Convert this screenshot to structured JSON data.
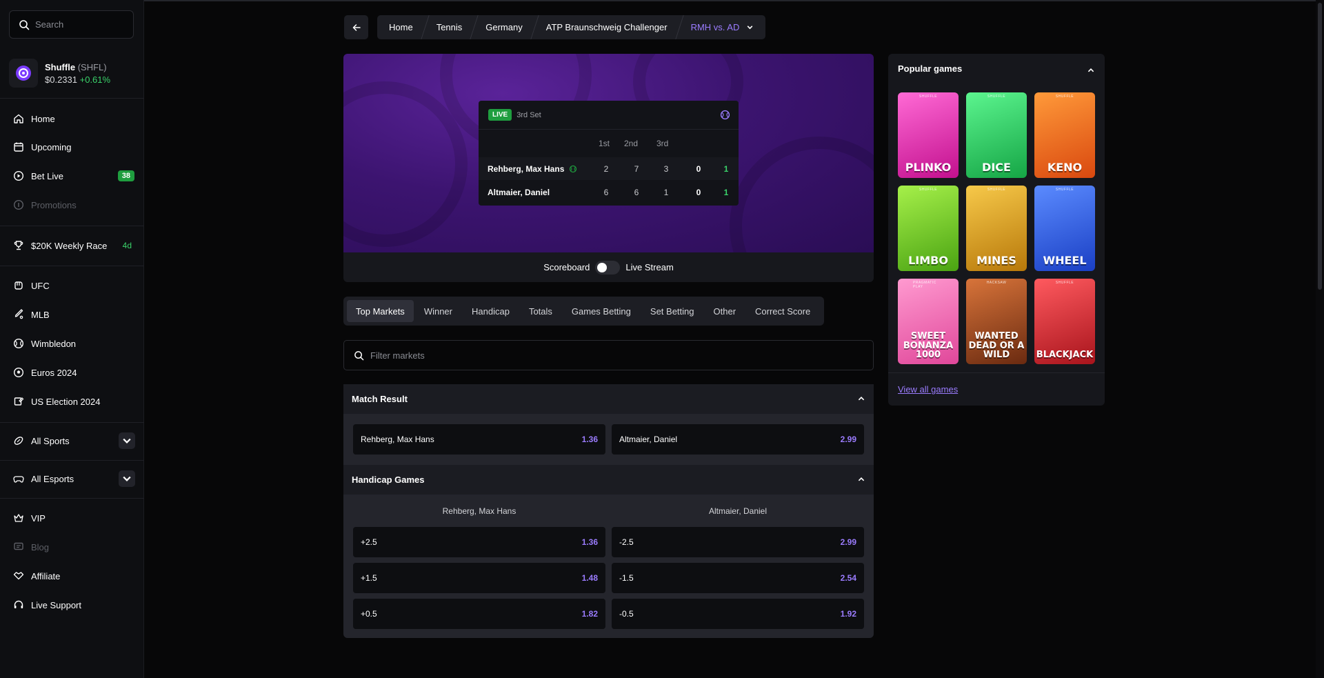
{
  "search": {
    "placeholder": "Search"
  },
  "token": {
    "name": "Shuffle",
    "symbol": "(SHFL)",
    "price": "$0.2331",
    "change": "+0.61%"
  },
  "nav": {
    "home": "Home",
    "upcoming": "Upcoming",
    "bet_live": "Bet Live",
    "bet_live_count": "38",
    "promotions": "Promotions",
    "race": "$20K Weekly Race",
    "race_badge": "4d",
    "ufc": "UFC",
    "mlb": "MLB",
    "wimbledon": "Wimbledon",
    "euros": "Euros 2024",
    "us_election": "US Election 2024",
    "all_sports": "All Sports",
    "all_esports": "All Esports",
    "vip": "VIP",
    "blog": "Blog",
    "affiliate": "Affiliate",
    "live_support": "Live Support"
  },
  "breadcrumb": [
    "Home",
    "Tennis",
    "Germany",
    "ATP Braunschweig Challenger",
    "RMH vs. AD"
  ],
  "scoreboard": {
    "live": "LIVE",
    "set": "3rd Set",
    "cols": [
      "1st",
      "2nd",
      "3rd"
    ],
    "players": [
      {
        "name": "Rehberg, Max Hans",
        "sets": [
          "2",
          "7",
          "3"
        ],
        "game": "0",
        "total": "1"
      },
      {
        "name": "Altmaier, Daniel",
        "sets": [
          "6",
          "6",
          "1"
        ],
        "game": "0",
        "total": "1"
      }
    ]
  },
  "view_toggle": {
    "left": "Scoreboard",
    "right": "Live Stream"
  },
  "tabs": [
    "Top Markets",
    "Winner",
    "Handicap",
    "Totals",
    "Games Betting",
    "Set Betting",
    "Other",
    "Correct Score"
  ],
  "filter": {
    "placeholder": "Filter markets"
  },
  "match_result": {
    "title": "Match Result",
    "odds": [
      {
        "label": "Rehberg, Max Hans",
        "price": "1.36"
      },
      {
        "label": "Altmaier, Daniel",
        "price": "2.99"
      }
    ]
  },
  "handicap": {
    "title": "Handicap Games",
    "headers": [
      "Rehberg, Max Hans",
      "Altmaier, Daniel"
    ],
    "rows": [
      {
        "left": "+2.5",
        "left_price": "1.36",
        "right": "-2.5",
        "right_price": "2.99"
      },
      {
        "left": "+1.5",
        "left_price": "1.48",
        "right": "-1.5",
        "right_price": "2.54"
      },
      {
        "left": "+0.5",
        "left_price": "1.82",
        "right": "-0.5",
        "right_price": "1.92"
      }
    ]
  },
  "popular": {
    "title": "Popular games",
    "view_all": "View all games",
    "games": [
      {
        "name": "PLINKO",
        "tag": "SHUFFLE",
        "color": "#ff3cc7"
      },
      {
        "name": "DICE",
        "tag": "SHUFFLE",
        "color": "#2fe06a"
      },
      {
        "name": "KENO",
        "tag": "SHUFFLE",
        "color": "#ff7a1a"
      },
      {
        "name": "LIMBO",
        "tag": "SHUFFLE",
        "color": "#7fe02a"
      },
      {
        "name": "MINES",
        "tag": "SHUFFLE",
        "color": "#f2b01e"
      },
      {
        "name": "WHEEL",
        "tag": "SHUFFLE",
        "color": "#3a6bff"
      },
      {
        "name": "SWEET BONANZA 1000",
        "tag": "PRAGMATIC PLAY",
        "color": "#ff6fb5"
      },
      {
        "name": "WANTED DEAD OR A WILD",
        "tag": "HACKSAW",
        "color": "#c2552a"
      },
      {
        "name": "BLACKJACK",
        "tag": "SHUFFLE",
        "color": "#e0383f"
      }
    ]
  }
}
